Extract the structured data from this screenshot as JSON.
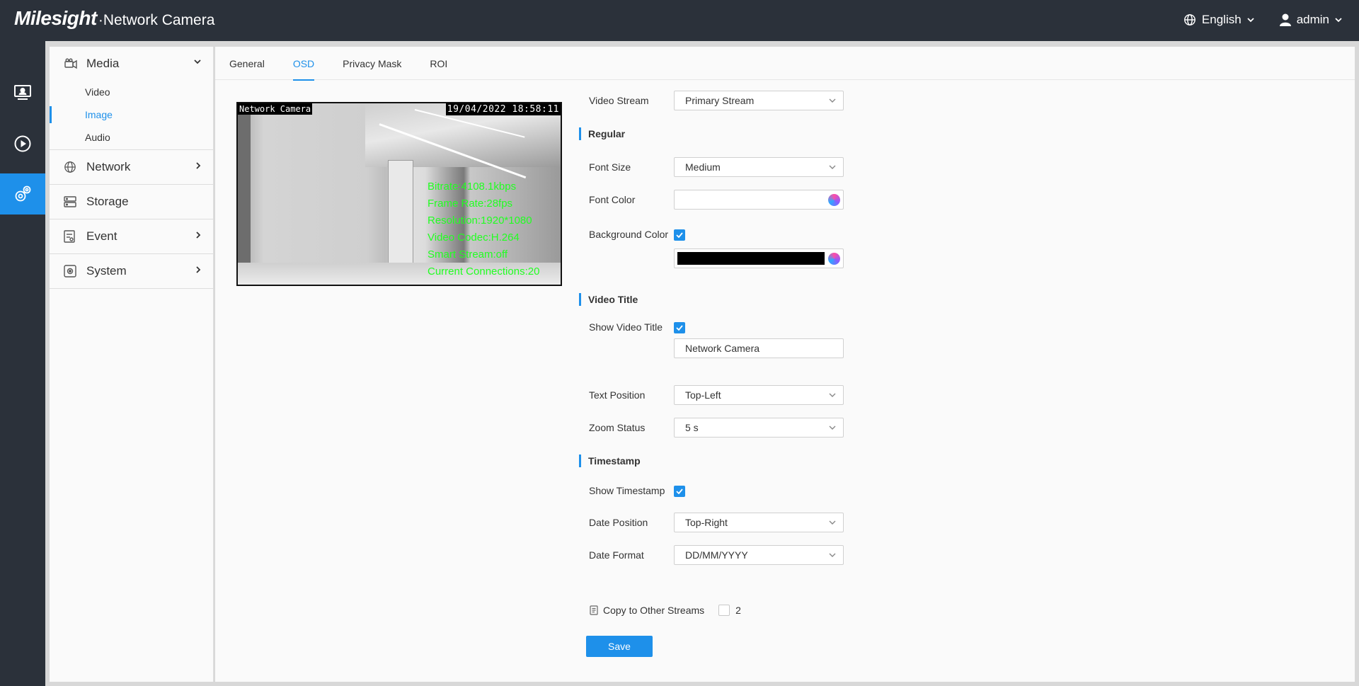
{
  "header": {
    "brand": "Milesight",
    "product": "·Network Camera",
    "language": "English",
    "user": "admin"
  },
  "rail": [
    {
      "icon": "live-view-icon"
    },
    {
      "icon": "playback-icon"
    },
    {
      "icon": "settings-icon"
    }
  ],
  "sidebar": {
    "media": {
      "label": "Media",
      "items": [
        "Video",
        "Image",
        "Audio"
      ],
      "active": "Image"
    },
    "network": "Network",
    "storage": "Storage",
    "event": "Event",
    "system": "System"
  },
  "tabs": [
    "General",
    "OSD",
    "Privacy Mask",
    "ROI"
  ],
  "active_tab": "OSD",
  "preview": {
    "title": "Network Camera",
    "timestamp": "19/04/2022 18:58:11",
    "stats": [
      "Bitrate:4108.1kbps",
      "Frame Rate:28fps",
      "Resolution:1920*1080",
      "Video Codec:H.264",
      "Smart Stream:off",
      "Current Connections:20"
    ]
  },
  "form": {
    "video_stream": {
      "label": "Video Stream",
      "value": "Primary Stream"
    },
    "regular_title": "Regular",
    "font_size": {
      "label": "Font Size",
      "value": "Medium"
    },
    "font_color": {
      "label": "Font Color",
      "color": "#ffffff"
    },
    "background_color": {
      "label": "Background Color",
      "checked": true,
      "color": "#000000"
    },
    "video_title_section": "Video Title",
    "show_video_title": {
      "label": "Show Video Title",
      "checked": true,
      "value": "Network Camera"
    },
    "text_position": {
      "label": "Text Position",
      "value": "Top-Left"
    },
    "zoom_status": {
      "label": "Zoom Status",
      "value": "5 s"
    },
    "timestamp_section": "Timestamp",
    "show_timestamp": {
      "label": "Show Timestamp",
      "checked": true
    },
    "date_position": {
      "label": "Date Position",
      "value": "Top-Right"
    },
    "date_format": {
      "label": "Date Format",
      "value": "DD/MM/YYYY"
    }
  },
  "copy": {
    "label": "Copy to Other Streams",
    "stream": "2"
  },
  "save_label": "Save",
  "colors": {
    "accent": "#1e90ea",
    "topbar": "#2b313a",
    "osd_text": "#22ff22"
  }
}
